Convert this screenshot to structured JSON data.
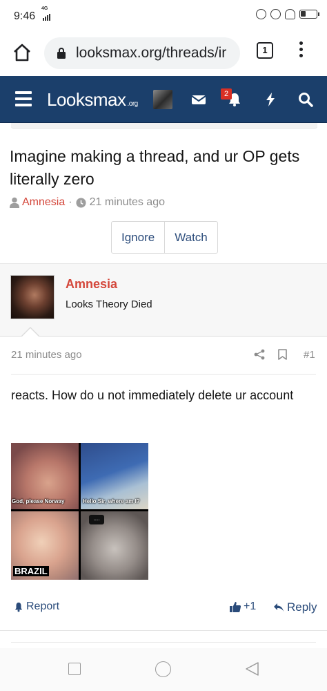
{
  "status_bar": {
    "time": "9:46",
    "network": "4G"
  },
  "browser": {
    "url": "looksmax.org/threads/ir",
    "tab_count": "1"
  },
  "site_nav": {
    "logo_text": "Looksmax",
    "logo_suffix": ".org",
    "notification_count": "2"
  },
  "thread": {
    "title": "Imagine making a thread, and ur OP gets literally zero",
    "author": "Amnesia",
    "separator": "·",
    "time": "21 minutes ago",
    "ignore_label": "Ignore",
    "watch_label": "Watch"
  },
  "post": {
    "author": "Amnesia",
    "user_title": "Looks Theory Died",
    "time": "21 minutes ago",
    "number": "#1",
    "body": "reacts. How do u not immediately delete ur account",
    "meme": {
      "caption_1": "God, please Norway",
      "caption_2": "Hello Sir, where am I?",
      "caption_3": "BRAZIL",
      "bubble": "...."
    },
    "report_label": "Report",
    "like_count": "+1",
    "reply_label": "Reply"
  },
  "colors": {
    "nav_bg": "#1b3f6b",
    "author_red": "#d4463a",
    "link_blue": "#2a4b7a",
    "badge_red": "#d93025"
  },
  "icons": [
    "home-icon",
    "lock-icon",
    "tabs-icon",
    "menu-dots-icon",
    "hamburger-icon",
    "mail-icon",
    "bell-icon",
    "bolt-icon",
    "search-icon",
    "user-icon",
    "clock-icon",
    "share-icon",
    "bookmark-icon",
    "bell-small-icon",
    "thumb-up-icon",
    "reply-icon"
  ]
}
